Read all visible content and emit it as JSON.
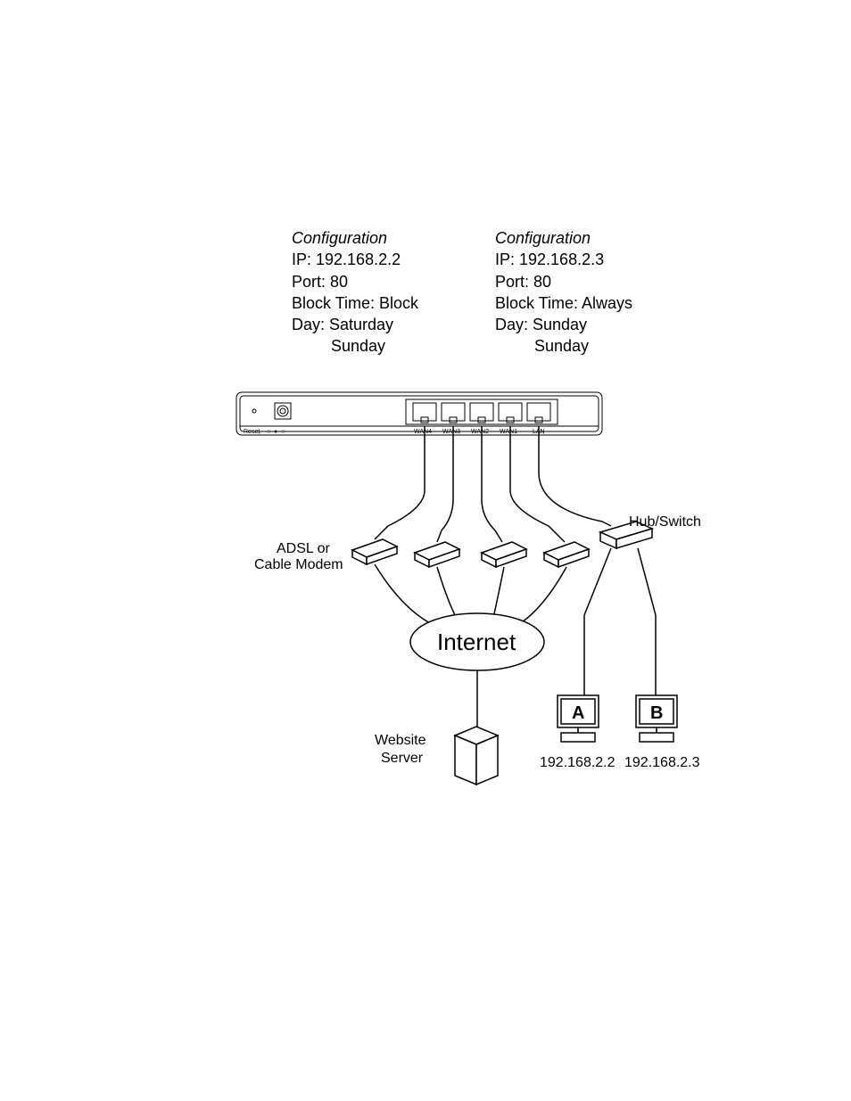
{
  "config_a": {
    "title": "Configuration",
    "ip": "IP: 192.168.2.2",
    "port": "Port: 80",
    "block": "Block Time: Block",
    "day": "Day: Saturday",
    "day2": "Sunday"
  },
  "config_b": {
    "title": "Configuration",
    "ip": "IP: 192.168.2.3",
    "port": "Port: 80",
    "block": "Block Time: Always",
    "day": "Day: Sunday",
    "day2": "Sunday"
  },
  "diagram": {
    "router_ports": {
      "p1": "WAN4",
      "p2": "WAN3",
      "p3": "WAN2",
      "p4": "WAN1",
      "p5": "LAN",
      "reset": "Reset"
    },
    "modem_label": "ADSL or",
    "modem_label2": "Cable Modem",
    "hub_label": "Hub/Switch",
    "internet": "Internet",
    "server_label": "Website",
    "server_label2": "Server",
    "pc_a": "A",
    "pc_b": "B",
    "ip_a": "192.168.2.2",
    "ip_b": "192.168.2.3",
    "leds": {
      "l1": "○",
      "l2": "●",
      "l3": "○"
    }
  }
}
